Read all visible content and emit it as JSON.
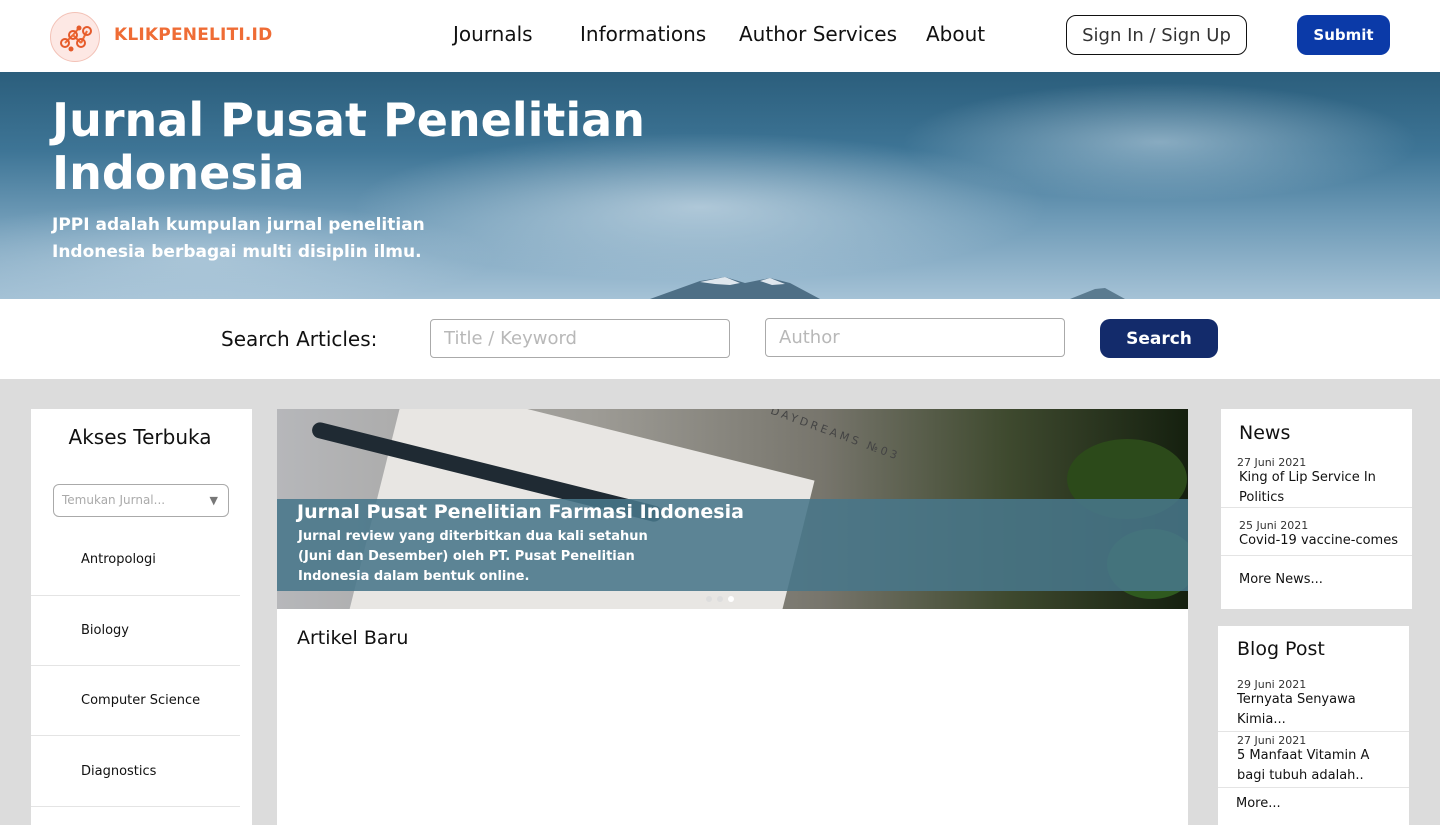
{
  "brand": {
    "name": "KLIKPENELITI.ID",
    "logo_icon": "network-nodes-icon",
    "accent": "#ef6c35"
  },
  "nav": {
    "items": [
      {
        "label": "Journals"
      },
      {
        "label": "Informations"
      },
      {
        "label": "Author Services"
      },
      {
        "label": "About"
      }
    ],
    "signin_label": "Sign In / Sign Up",
    "submit_label": "Submit"
  },
  "hero": {
    "title": "Jurnal Pusat Penelitian Indonesia",
    "subtitle": "JPPI adalah kumpulan jurnal penelitian Indonesia berbagai multi disiplin ilmu."
  },
  "search": {
    "label": "Search Articles:",
    "keyword_placeholder": "Title / Keyword",
    "author_placeholder": "Author",
    "button_label": "Search"
  },
  "sidebar": {
    "title": "Akses Terbuka",
    "select_placeholder": "Temukan Jurnal...",
    "categories": [
      {
        "label": "Antropologi"
      },
      {
        "label": "Biology"
      },
      {
        "label": "Computer Science"
      },
      {
        "label": "Diagnostics"
      }
    ]
  },
  "banner": {
    "notebook_text": "DAYDREAMS №03",
    "title": "Jurnal Pusat Penelitian Farmasi Indonesia",
    "description": "Jurnal review yang diterbitkan dua kali setahun (Juni dan Desember) oleh PT. Pusat Penelitian Indonesia dalam bentuk online.",
    "slide_count": 3,
    "active_slide": 3
  },
  "articles": {
    "title": "Artikel Baru"
  },
  "news": {
    "title": "News",
    "items": [
      {
        "date": "27 Juni 2021",
        "title": "King of Lip Service In Politics"
      },
      {
        "date": "25 Juni 2021",
        "title": "Covid-19 vaccine-comes"
      }
    ],
    "more_label": "More News..."
  },
  "blog": {
    "title": "Blog Post",
    "items": [
      {
        "date": "29 Juni 2021",
        "title": "Ternyata Senyawa Kimia..."
      },
      {
        "date": "27 Juni 2021",
        "title": "5 Manfaat Vitamin A bagi tubuh adalah.."
      }
    ],
    "more_label": "More..."
  },
  "colors": {
    "submit_button": "#0b3aa8",
    "search_button": "#132b6b",
    "page_background": "#dcdcdc"
  }
}
